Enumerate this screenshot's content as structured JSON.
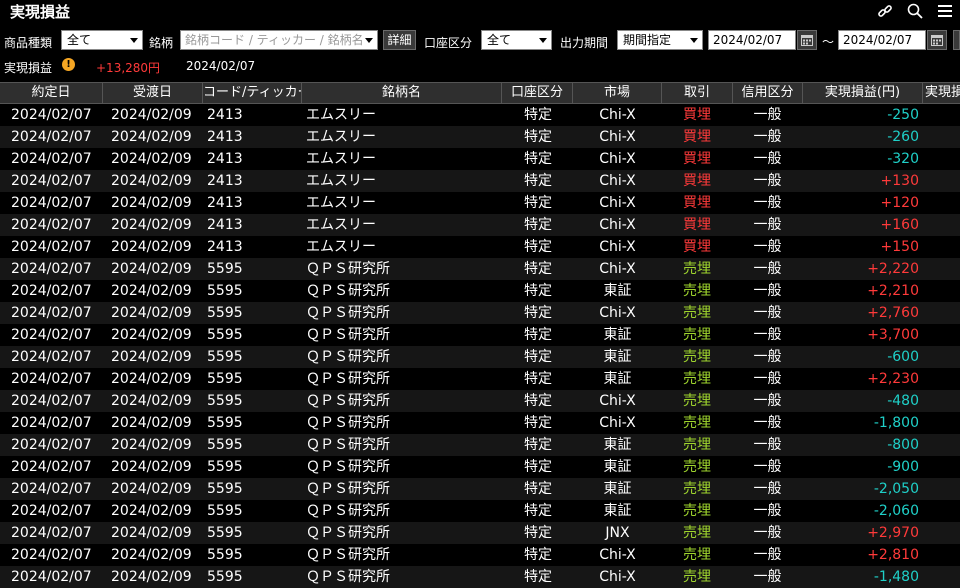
{
  "window": {
    "title": "実現損益",
    "icons": [
      "link-icon",
      "search-icon",
      "menu-icon"
    ]
  },
  "filters": {
    "product_type_label": "商品種類",
    "product_type_value": "全て",
    "symbol_label": "銘柄",
    "symbol_placeholder": "銘柄コード / ティッカー / 銘柄名",
    "detail_button": "詳細",
    "account_label": "口座区分",
    "account_value": "全て",
    "period_label": "出力期間",
    "period_value": "期間指定",
    "date_from": "2024/02/07",
    "date_sep": "～",
    "date_to": "2024/02/07"
  },
  "summary": {
    "label": "実現損益",
    "value": "+13,280円",
    "date": "2024/02/07"
  },
  "table": {
    "headers": [
      "約定日",
      "受渡日",
      "コード/ティッカー",
      "銘柄名",
      "口座区分",
      "市場",
      "取引",
      "信用区分",
      "実現損益(円)",
      "実現損"
    ],
    "rows": [
      {
        "trade_date": "2024/02/07",
        "settle_date": "2024/02/09",
        "code": "2413",
        "name": "エムスリー",
        "account": "特定",
        "market": "Chi-X",
        "side": "買埋",
        "side_type": "buy",
        "credit": "一般",
        "pl": "-250",
        "pl_sign": "neg"
      },
      {
        "trade_date": "2024/02/07",
        "settle_date": "2024/02/09",
        "code": "2413",
        "name": "エムスリー",
        "account": "特定",
        "market": "Chi-X",
        "side": "買埋",
        "side_type": "buy",
        "credit": "一般",
        "pl": "-260",
        "pl_sign": "neg"
      },
      {
        "trade_date": "2024/02/07",
        "settle_date": "2024/02/09",
        "code": "2413",
        "name": "エムスリー",
        "account": "特定",
        "market": "Chi-X",
        "side": "買埋",
        "side_type": "buy",
        "credit": "一般",
        "pl": "-320",
        "pl_sign": "neg"
      },
      {
        "trade_date": "2024/02/07",
        "settle_date": "2024/02/09",
        "code": "2413",
        "name": "エムスリー",
        "account": "特定",
        "market": "Chi-X",
        "side": "買埋",
        "side_type": "buy",
        "credit": "一般",
        "pl": "+130",
        "pl_sign": "pos"
      },
      {
        "trade_date": "2024/02/07",
        "settle_date": "2024/02/09",
        "code": "2413",
        "name": "エムスリー",
        "account": "特定",
        "market": "Chi-X",
        "side": "買埋",
        "side_type": "buy",
        "credit": "一般",
        "pl": "+120",
        "pl_sign": "pos"
      },
      {
        "trade_date": "2024/02/07",
        "settle_date": "2024/02/09",
        "code": "2413",
        "name": "エムスリー",
        "account": "特定",
        "market": "Chi-X",
        "side": "買埋",
        "side_type": "buy",
        "credit": "一般",
        "pl": "+160",
        "pl_sign": "pos"
      },
      {
        "trade_date": "2024/02/07",
        "settle_date": "2024/02/09",
        "code": "2413",
        "name": "エムスリー",
        "account": "特定",
        "market": "Chi-X",
        "side": "買埋",
        "side_type": "buy",
        "credit": "一般",
        "pl": "+150",
        "pl_sign": "pos"
      },
      {
        "trade_date": "2024/02/07",
        "settle_date": "2024/02/09",
        "code": "5595",
        "name": "ＱＰＳ研究所",
        "account": "特定",
        "market": "Chi-X",
        "side": "売埋",
        "side_type": "sell",
        "credit": "一般",
        "pl": "+2,220",
        "pl_sign": "pos"
      },
      {
        "trade_date": "2024/02/07",
        "settle_date": "2024/02/09",
        "code": "5595",
        "name": "ＱＰＳ研究所",
        "account": "特定",
        "market": "東証",
        "side": "売埋",
        "side_type": "sell",
        "credit": "一般",
        "pl": "+2,210",
        "pl_sign": "pos"
      },
      {
        "trade_date": "2024/02/07",
        "settle_date": "2024/02/09",
        "code": "5595",
        "name": "ＱＰＳ研究所",
        "account": "特定",
        "market": "Chi-X",
        "side": "売埋",
        "side_type": "sell",
        "credit": "一般",
        "pl": "+2,760",
        "pl_sign": "pos"
      },
      {
        "trade_date": "2024/02/07",
        "settle_date": "2024/02/09",
        "code": "5595",
        "name": "ＱＰＳ研究所",
        "account": "特定",
        "market": "東証",
        "side": "売埋",
        "side_type": "sell",
        "credit": "一般",
        "pl": "+3,700",
        "pl_sign": "pos"
      },
      {
        "trade_date": "2024/02/07",
        "settle_date": "2024/02/09",
        "code": "5595",
        "name": "ＱＰＳ研究所",
        "account": "特定",
        "market": "東証",
        "side": "売埋",
        "side_type": "sell",
        "credit": "一般",
        "pl": "-600",
        "pl_sign": "neg"
      },
      {
        "trade_date": "2024/02/07",
        "settle_date": "2024/02/09",
        "code": "5595",
        "name": "ＱＰＳ研究所",
        "account": "特定",
        "market": "東証",
        "side": "売埋",
        "side_type": "sell",
        "credit": "一般",
        "pl": "+2,230",
        "pl_sign": "pos"
      },
      {
        "trade_date": "2024/02/07",
        "settle_date": "2024/02/09",
        "code": "5595",
        "name": "ＱＰＳ研究所",
        "account": "特定",
        "market": "Chi-X",
        "side": "売埋",
        "side_type": "sell",
        "credit": "一般",
        "pl": "-480",
        "pl_sign": "neg"
      },
      {
        "trade_date": "2024/02/07",
        "settle_date": "2024/02/09",
        "code": "5595",
        "name": "ＱＰＳ研究所",
        "account": "特定",
        "market": "Chi-X",
        "side": "売埋",
        "side_type": "sell",
        "credit": "一般",
        "pl": "-1,800",
        "pl_sign": "neg"
      },
      {
        "trade_date": "2024/02/07",
        "settle_date": "2024/02/09",
        "code": "5595",
        "name": "ＱＰＳ研究所",
        "account": "特定",
        "market": "東証",
        "side": "売埋",
        "side_type": "sell",
        "credit": "一般",
        "pl": "-800",
        "pl_sign": "neg"
      },
      {
        "trade_date": "2024/02/07",
        "settle_date": "2024/02/09",
        "code": "5595",
        "name": "ＱＰＳ研究所",
        "account": "特定",
        "market": "東証",
        "side": "売埋",
        "side_type": "sell",
        "credit": "一般",
        "pl": "-900",
        "pl_sign": "neg"
      },
      {
        "trade_date": "2024/02/07",
        "settle_date": "2024/02/09",
        "code": "5595",
        "name": "ＱＰＳ研究所",
        "account": "特定",
        "market": "東証",
        "side": "売埋",
        "side_type": "sell",
        "credit": "一般",
        "pl": "-2,050",
        "pl_sign": "neg"
      },
      {
        "trade_date": "2024/02/07",
        "settle_date": "2024/02/09",
        "code": "5595",
        "name": "ＱＰＳ研究所",
        "account": "特定",
        "market": "東証",
        "side": "売埋",
        "side_type": "sell",
        "credit": "一般",
        "pl": "-2,060",
        "pl_sign": "neg"
      },
      {
        "trade_date": "2024/02/07",
        "settle_date": "2024/02/09",
        "code": "5595",
        "name": "ＱＰＳ研究所",
        "account": "特定",
        "market": "JNX",
        "side": "売埋",
        "side_type": "sell",
        "credit": "一般",
        "pl": "+2,970",
        "pl_sign": "pos"
      },
      {
        "trade_date": "2024/02/07",
        "settle_date": "2024/02/09",
        "code": "5595",
        "name": "ＱＰＳ研究所",
        "account": "特定",
        "market": "Chi-X",
        "side": "売埋",
        "side_type": "sell",
        "credit": "一般",
        "pl": "+2,810",
        "pl_sign": "pos"
      },
      {
        "trade_date": "2024/02/07",
        "settle_date": "2024/02/09",
        "code": "5595",
        "name": "ＱＰＳ研究所",
        "account": "特定",
        "market": "Chi-X",
        "side": "売埋",
        "side_type": "sell",
        "credit": "一般",
        "pl": "-1,480",
        "pl_sign": "neg"
      }
    ]
  },
  "colors": {
    "buy": "#ff3a3a",
    "sell": "#a0d62e",
    "profit": "#ff3a3a",
    "loss": "#1fd0c8",
    "warning": "#f5a623"
  }
}
